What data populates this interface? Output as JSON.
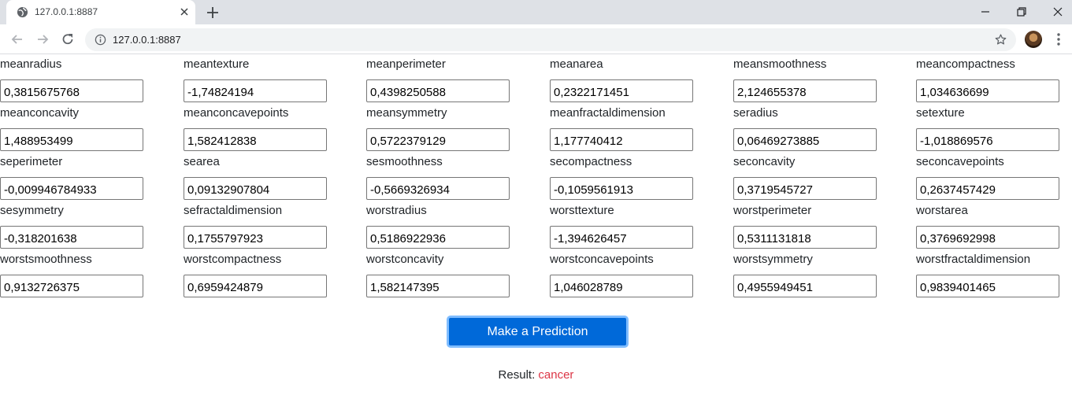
{
  "browser": {
    "tab_title": "127.0.0.1:8887",
    "url": "127.0.0.1:8887"
  },
  "fields": [
    {
      "label": "meanradius",
      "value": "0,3815675768"
    },
    {
      "label": "meantexture",
      "value": "-1,74824194"
    },
    {
      "label": "meanperimeter",
      "value": "0,4398250588"
    },
    {
      "label": "meanarea",
      "value": "0,2322171451"
    },
    {
      "label": "meansmoothness",
      "value": "2,124655378"
    },
    {
      "label": "meancompactness",
      "value": "1,034636699"
    },
    {
      "label": "meanconcavity",
      "value": "1,488953499"
    },
    {
      "label": "meanconcavepoints",
      "value": "1,582412838"
    },
    {
      "label": "meansymmetry",
      "value": "0,5722379129"
    },
    {
      "label": "meanfractaldimension",
      "value": "1,177740412"
    },
    {
      "label": "seradius",
      "value": "0,06469273885"
    },
    {
      "label": "setexture",
      "value": "-1,018869576"
    },
    {
      "label": "seperimeter",
      "value": "-0,009946784933"
    },
    {
      "label": "searea",
      "value": "0,09132907804"
    },
    {
      "label": "sesmoothness",
      "value": "-0,5669326934"
    },
    {
      "label": "secompactness",
      "value": "-0,1059561913"
    },
    {
      "label": "seconcavity",
      "value": "0,3719545727"
    },
    {
      "label": "seconcavepoints",
      "value": "0,2637457429"
    },
    {
      "label": "sesymmetry",
      "value": "-0,318201638"
    },
    {
      "label": "sefractaldimension",
      "value": "0,1755797923"
    },
    {
      "label": "worstradius",
      "value": "0,5186922936"
    },
    {
      "label": "worsttexture",
      "value": "-1,394626457"
    },
    {
      "label": "worstperimeter",
      "value": "0,5311131818"
    },
    {
      "label": "worstarea",
      "value": "0,3769692998"
    },
    {
      "label": "worstsmoothness",
      "value": "0,9132726375"
    },
    {
      "label": "worstcompactness",
      "value": "0,6959424879"
    },
    {
      "label": "worstconcavity",
      "value": "1,582147395"
    },
    {
      "label": "worstconcavepoints",
      "value": "1,046028789"
    },
    {
      "label": "worstsymmetry",
      "value": "0,4955949451"
    },
    {
      "label": "worstfractaldimension",
      "value": "0,9839401465"
    }
  ],
  "predict_button": "Make a Prediction",
  "result": {
    "label": "Result:",
    "value": "cancer"
  },
  "colors": {
    "button": "#0069d9",
    "result_value": "#dc3545"
  }
}
